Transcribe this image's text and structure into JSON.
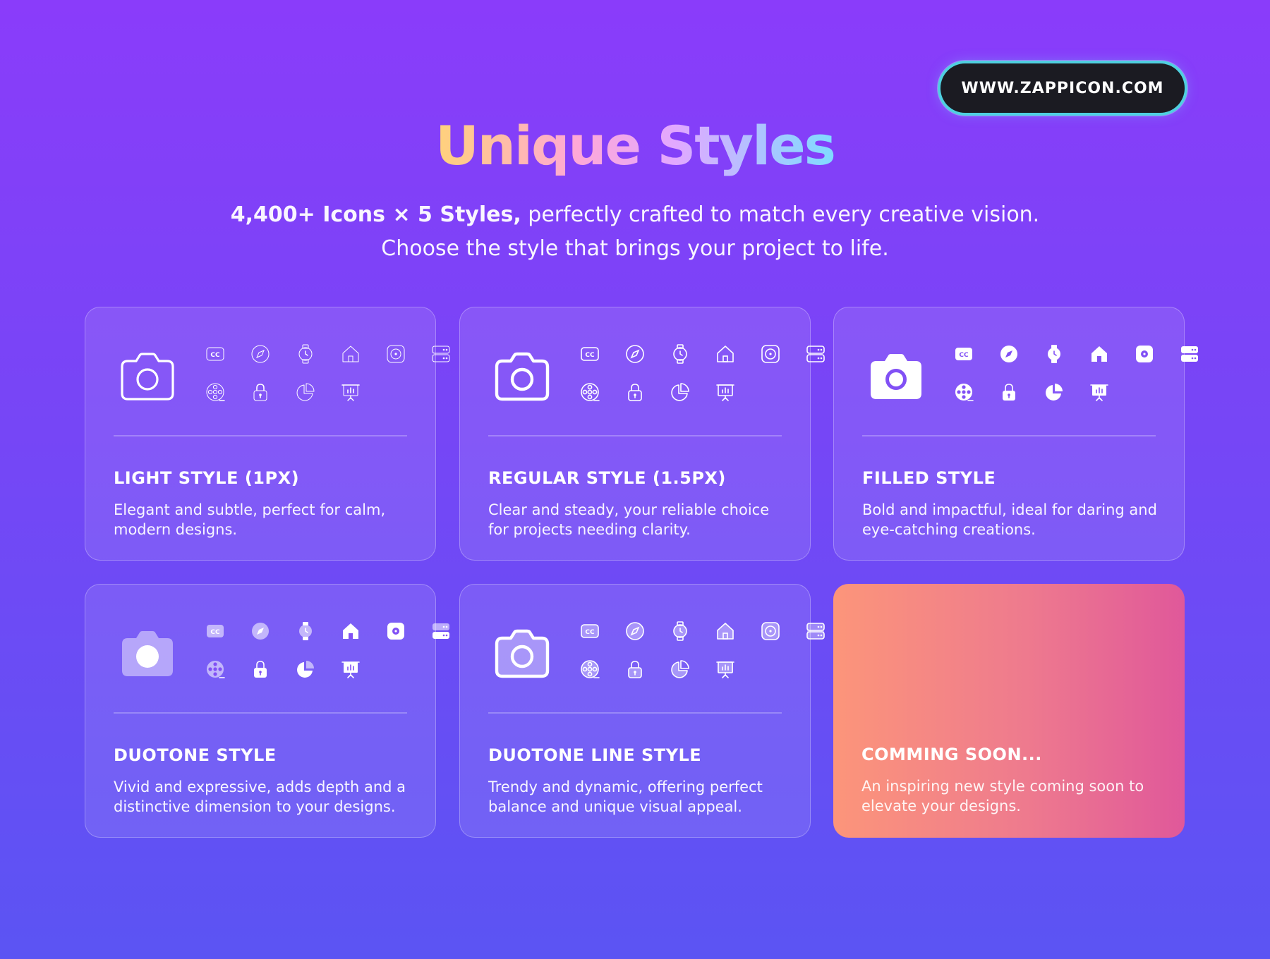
{
  "header": {
    "url": "WWW.ZAPPICON.COM",
    "title": "Unique Styles",
    "subtitle_bold": "4,400+ Icons × 5 Styles,",
    "subtitle_rest": " perfectly crafted to match every creative vision.",
    "subtitle_line2": "Choose the style that brings your project to life."
  },
  "cards": [
    {
      "style": "light",
      "title": "LIGHT STYLE (1PX)",
      "desc": "Elegant and subtle, perfect for calm, modern designs."
    },
    {
      "style": "regular",
      "title": "REGULAR STYLE  (1.5PX)",
      "desc": "Clear and steady, your reliable choice for projects needing clarity."
    },
    {
      "style": "filled",
      "title": "FILLED STYLE",
      "desc": "Bold and impactful, ideal for daring and eye-catching creations."
    },
    {
      "style": "duotone",
      "title": "DUOTONE STYLE",
      "desc": "Vivid and expressive, adds depth and a distinctive dimension to your designs."
    },
    {
      "style": "duoline",
      "title": "DUOTONE LINE  STYLE",
      "desc": "Trendy and dynamic, offering perfect balance and unique visual appeal."
    },
    {
      "style": "soon",
      "title": "COMMING SOON...",
      "desc": "An inspiring new style coming soon to elevate your designs."
    }
  ],
  "icons": [
    "cc-icon",
    "compass-icon",
    "watch-icon",
    "home-icon",
    "record-icon",
    "server-icon",
    "film-reel-icon",
    "lock-icon",
    "pie-chart-icon",
    "presentation-icon"
  ],
  "colors": {
    "accent_gradient": [
      "#ffd27a",
      "#ffa8d6",
      "#e2a8ff",
      "#7fdcff"
    ],
    "coming_soon": [
      "#fc957a",
      "#e0589a"
    ],
    "pill_border": "#4fd0e0"
  }
}
